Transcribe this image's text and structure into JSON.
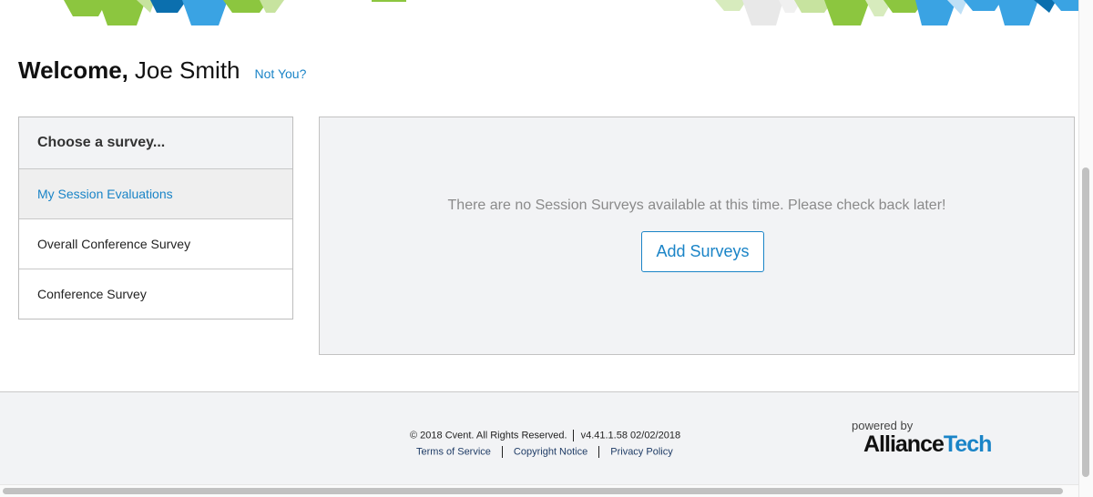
{
  "header": {
    "welcome_word": "Welcome,",
    "user_name": "Joe Smith",
    "not_you_link": "Not You?"
  },
  "sidebar": {
    "title": "Choose a survey...",
    "items": [
      {
        "label": "My Session Evaluations",
        "active": true
      },
      {
        "label": "Overall Conference Survey",
        "active": false
      },
      {
        "label": "Conference Survey",
        "active": false
      }
    ]
  },
  "main": {
    "empty_message": "There are no Session Surveys available at this time. Please check back later!",
    "add_button_label": "Add Surveys"
  },
  "footer": {
    "copyright": "© 2018 Cvent. All Rights Reserved.",
    "version": "v4.41.1.58 02/02/2018",
    "links": [
      "Terms of Service",
      "Copyright Notice",
      "Privacy Policy"
    ],
    "powered_by": "powered by",
    "brand_part1": "Alliance",
    "brand_part2": "Tech"
  },
  "colors": {
    "accent_blue": "#1a84c7",
    "panel_gray": "#f2f3f5",
    "hex_green": "#8cc63f",
    "hex_dark_blue": "#0b6fae",
    "hex_light_blue": "#3aa3e3"
  },
  "icons": [
    "hexagon-banner-decoration"
  ]
}
